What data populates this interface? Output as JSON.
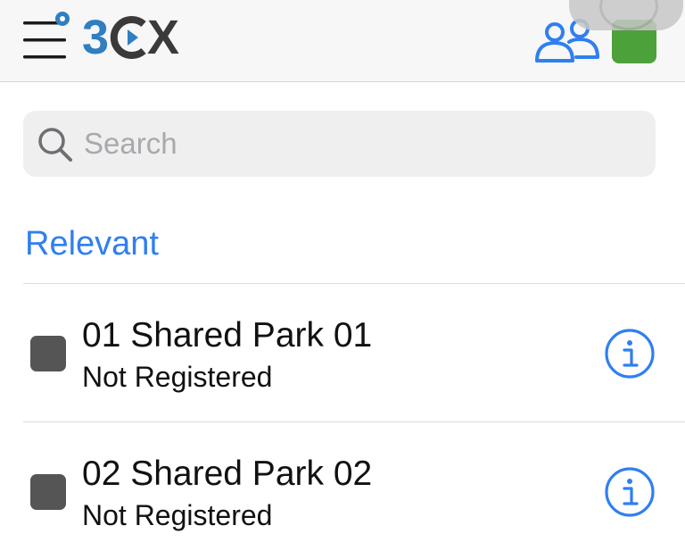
{
  "header": {
    "logo_text_3": "3",
    "logo_text_x": "X",
    "status_color": "#4da13a",
    "accent_color": "#2f7ff0"
  },
  "search": {
    "placeholder": "Search",
    "value": ""
  },
  "section": {
    "title": "Relevant"
  },
  "contacts": [
    {
      "name": "01 Shared Park 01",
      "status": "Not Registered",
      "status_color": "#555555",
      "icon": "info-icon"
    },
    {
      "name": "02 Shared Park 02",
      "status": "Not Registered",
      "status_color": "#555555",
      "icon": "info-icon"
    }
  ]
}
